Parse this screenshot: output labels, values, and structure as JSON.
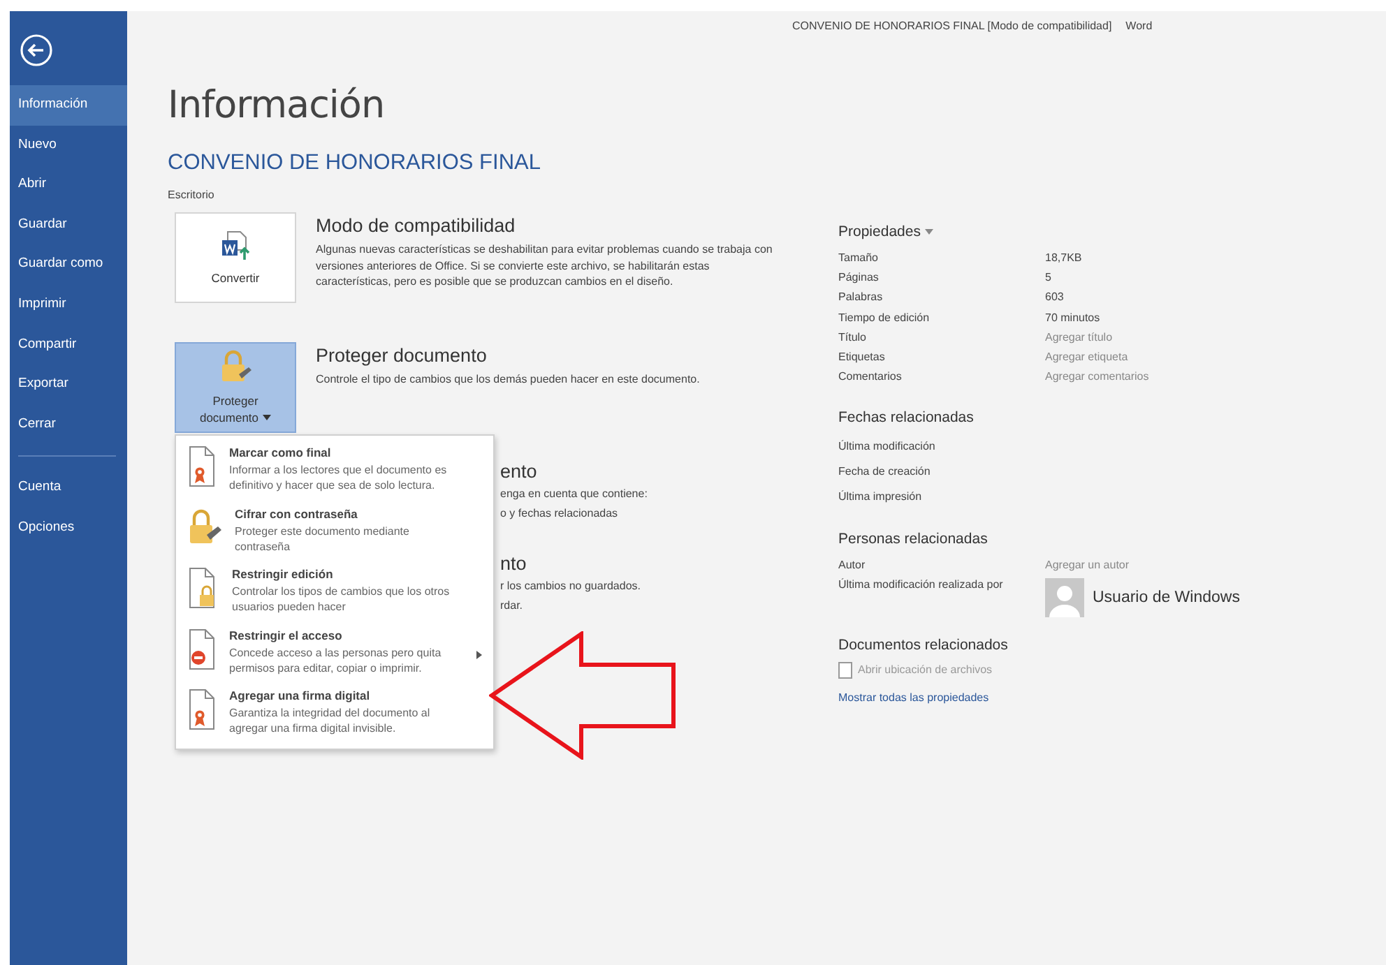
{
  "window": {
    "title": "CONVENIO DE HONORARIOS FINAL [Modo de compatibilidad]",
    "app": "Word"
  },
  "sidebar": {
    "items": [
      {
        "label": "Información",
        "selected": true
      },
      {
        "label": "Nuevo",
        "selected": false
      },
      {
        "label": "Abrir",
        "selected": false
      },
      {
        "label": "Guardar",
        "selected": false
      },
      {
        "label": "Guardar como",
        "selected": false
      },
      {
        "label": "Imprimir",
        "selected": false
      },
      {
        "label": "Compartir",
        "selected": false
      },
      {
        "label": "Exportar",
        "selected": false
      },
      {
        "label": "Cerrar",
        "selected": false
      }
    ],
    "footer_items": [
      {
        "label": "Cuenta",
        "selected": false
      },
      {
        "label": "Opciones",
        "selected": false
      }
    ]
  },
  "page": {
    "title": "Información",
    "document_name": "CONVENIO DE HONORARIOS FINAL",
    "location": "Escritorio"
  },
  "sections": [
    {
      "kind": "convert",
      "button_label": "Convertir",
      "pressed": false,
      "heading": "Modo de compatibilidad",
      "description": "Algunas nuevas características se deshabilitan para evitar problemas cuando se trabaja con versiones anteriores de Office. Si se convierte este archivo, se habilitarán estas características, pero es posible que se produzcan cambios en el diseño."
    },
    {
      "kind": "protect",
      "button_label": "Proteger documento",
      "pressed": true,
      "heading": "Proteger documento",
      "description": "Controle el tipo de cambios que los demás pueden hacer en este documento."
    }
  ],
  "covered_sections": [
    {
      "heading": "ento",
      "lines": [
        "enga en cuenta que contiene:",
        "o y fechas relacionadas"
      ]
    },
    {
      "heading": "nto",
      "lines": [
        "r los cambios no guardados.",
        "rdar."
      ]
    }
  ],
  "menu": {
    "items": [
      {
        "kind": "ribbon",
        "title": "Marcar como final",
        "description": "Informar a los lectores que el documento es definitivo y hacer que sea de solo lectura.",
        "submenu": false
      },
      {
        "kind": "lock-key",
        "title": "Cifrar con contraseña",
        "description": "Proteger este documento mediante contraseña",
        "submenu": false
      },
      {
        "kind": "lock",
        "title": "Restringir edición",
        "description": "Controlar los tipos de cambios que los otros usuarios pueden hacer",
        "submenu": false
      },
      {
        "kind": "no-entry",
        "title": "Restringir el acceso",
        "description": "Concede acceso a las personas pero quita permisos para editar, copiar o imprimir.",
        "submenu": true
      },
      {
        "kind": "ribbon",
        "title": "Agregar una firma digital",
        "description": "Garantiza la integridad del documento al agregar una firma digital invisible.",
        "submenu": false
      }
    ]
  },
  "properties": {
    "heading": "Propiedades",
    "rows": [
      {
        "label": "Tamaño",
        "value": "18,7KB",
        "kind": "value"
      },
      {
        "label": "Páginas",
        "value": "5",
        "kind": "value"
      },
      {
        "label": "Palabras",
        "value": "603",
        "kind": "value"
      },
      {
        "label": "Tiempo de edición",
        "value": "70 minutos",
        "kind": "value"
      },
      {
        "label": "Título",
        "placeholder": "Agregar título",
        "kind": "field"
      },
      {
        "label": "Etiquetas",
        "placeholder": "Agregar etiqueta",
        "kind": "field"
      },
      {
        "label": "Comentarios",
        "placeholder": "Agregar comentarios",
        "kind": "field"
      }
    ]
  },
  "related_dates": {
    "heading": "Fechas relacionadas",
    "rows": [
      "Última modificación",
      "Fecha de creación",
      "Última impresión"
    ]
  },
  "related_people": {
    "heading": "Personas relacionadas",
    "rows": [
      {
        "label": "Autor",
        "placeholder": "Agregar un autor",
        "kind": "field"
      },
      {
        "label": "Última modificación realizada por",
        "value": "Usuario de Windows",
        "kind": "user"
      }
    ]
  },
  "related_documents": {
    "heading": "Documentos relacionados",
    "open_location": {
      "label": "Abrir ubicación de archivos",
      "disabled": true
    },
    "show_all": "Mostrar todas las propiedades"
  }
}
